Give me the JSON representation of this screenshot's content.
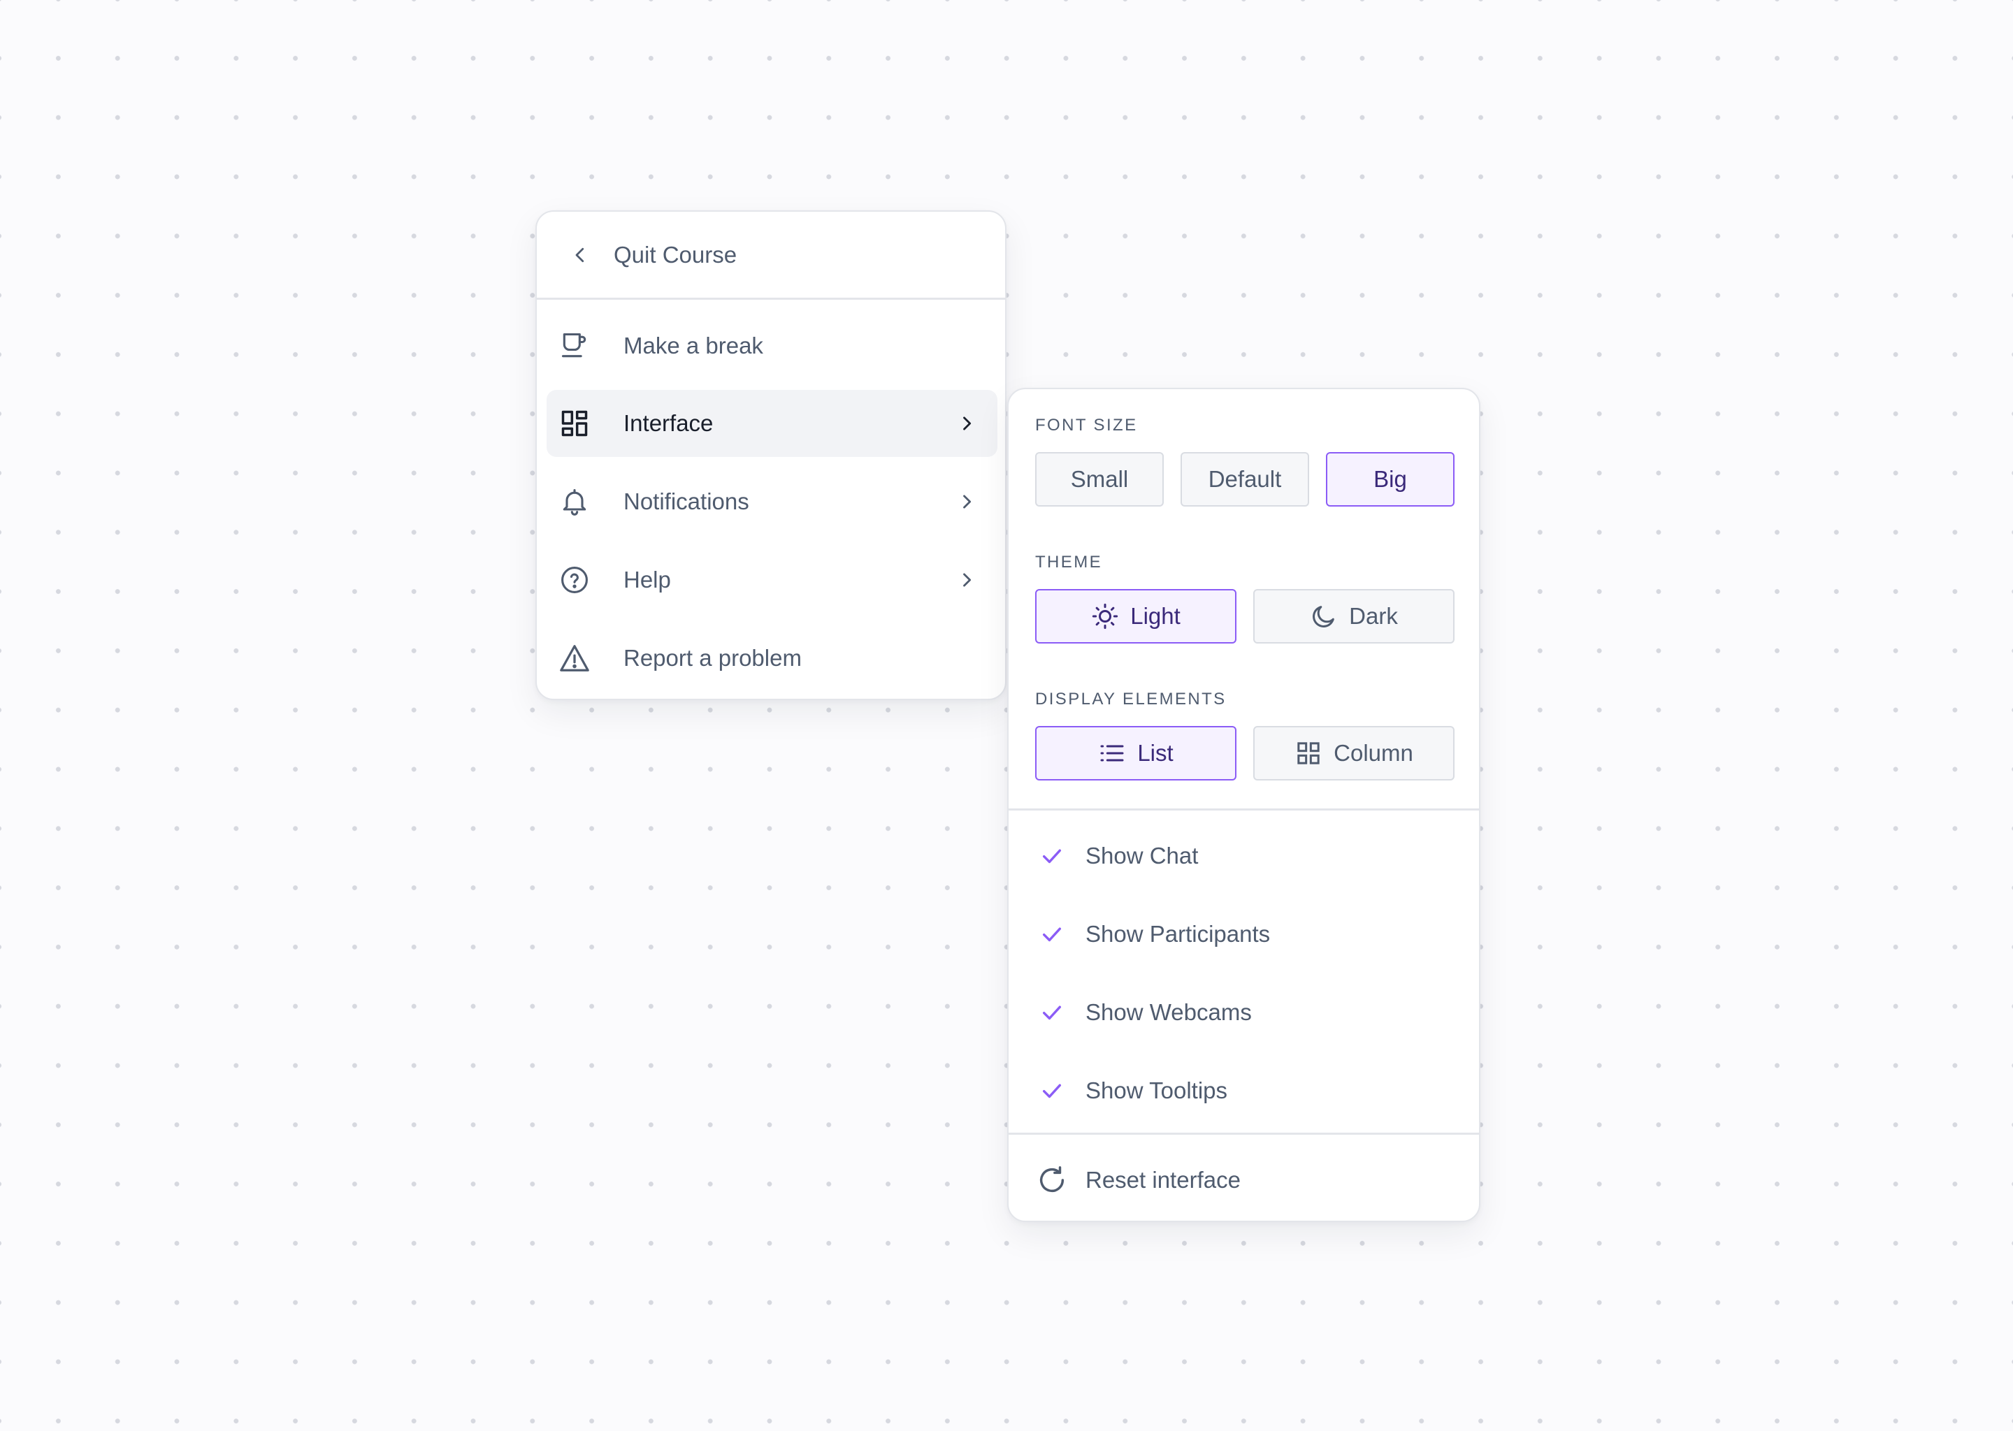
{
  "colors": {
    "accent": "#8b5cf6",
    "text": "#4f5b6e",
    "text_active": "#1a1f2b",
    "border": "#e3e5ea"
  },
  "menu": {
    "back": {
      "label": "Quit Course",
      "icon": "chevron-left-icon"
    },
    "items": [
      {
        "label": "Make a break",
        "icon": "coffee-cup-icon",
        "has_submenu": false
      },
      {
        "label": "Interface",
        "icon": "dashboard-layout-icon",
        "has_submenu": true,
        "active": true
      },
      {
        "label": "Notifications",
        "icon": "bell-icon",
        "has_submenu": true
      },
      {
        "label": "Help",
        "icon": "question-circle-icon",
        "has_submenu": true
      },
      {
        "label": "Report a problem",
        "icon": "warning-triangle-icon",
        "has_submenu": false
      }
    ]
  },
  "submenu": {
    "font_size": {
      "title": "FONT SIZE",
      "options": [
        "Small",
        "Default",
        "Big"
      ],
      "selected": "Big"
    },
    "theme": {
      "title": "THEME",
      "options": [
        {
          "label": "Light",
          "icon": "sun-icon"
        },
        {
          "label": "Dark",
          "icon": "moon-icon"
        }
      ],
      "selected": "Light"
    },
    "display": {
      "title": "DISPLAY ELEMENTS",
      "options": [
        {
          "label": "List",
          "icon": "list-icon"
        },
        {
          "label": "Column",
          "icon": "grid-icon"
        }
      ],
      "selected": "List"
    },
    "toggles": [
      {
        "label": "Show Chat",
        "checked": true
      },
      {
        "label": "Show Participants",
        "checked": true
      },
      {
        "label": "Show Webcams",
        "checked": true
      },
      {
        "label": "Show Tooltips",
        "checked": true
      }
    ],
    "reset": {
      "label": "Reset interface",
      "icon": "refresh-icon"
    }
  }
}
